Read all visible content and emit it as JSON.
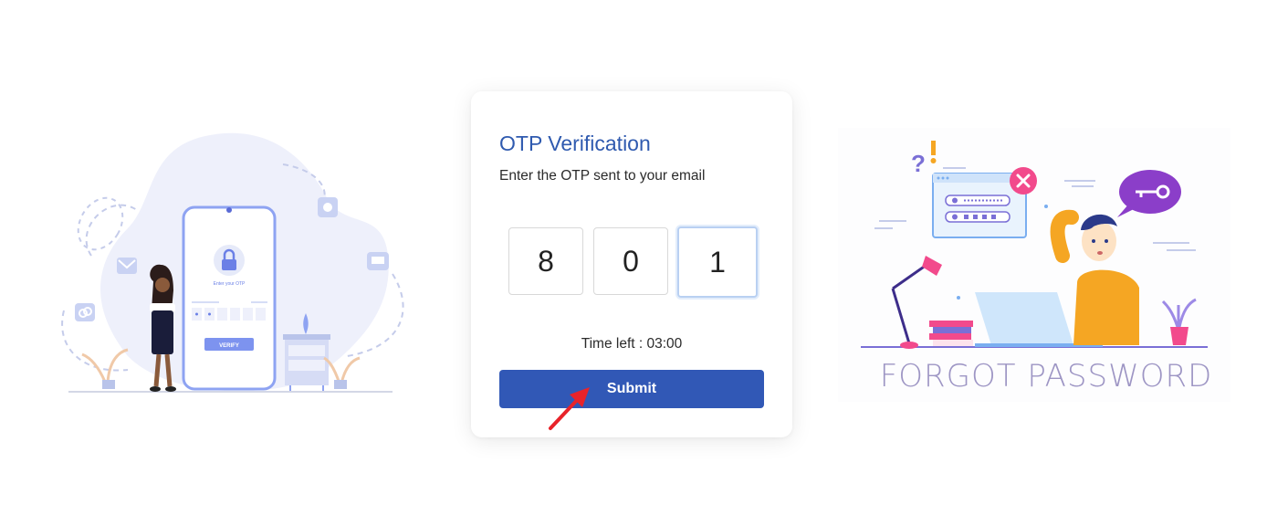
{
  "otp_card": {
    "title": "OTP Verification",
    "subtitle": "Enter the OTP sent to your email",
    "digits": [
      "8",
      "0",
      "1"
    ],
    "timer_label": "Time left : 03:00",
    "submit_label": "Submit"
  },
  "left_illustration": {
    "phone_prompt": "Enter your OTP",
    "verify_label": "VERIFY",
    "otp_dots": [
      "*",
      "*"
    ]
  },
  "right_illustration": {
    "caption": "FORGOT PASSWORD"
  },
  "colors": {
    "accent": "#3158b6",
    "title": "#2f5aaf",
    "illustration_blue": "#8ea3f2",
    "illustration_bg": "#eef0fb"
  }
}
